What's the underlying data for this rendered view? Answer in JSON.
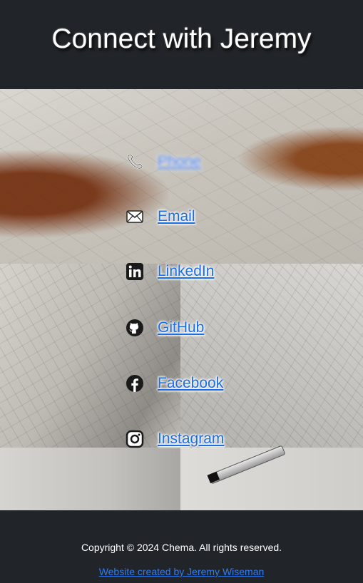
{
  "header": {
    "title": "Connect with Jeremy"
  },
  "links": [
    {
      "label": "Phone",
      "icon": "phone-icon"
    },
    {
      "label": "Email",
      "icon": "envelope-icon"
    },
    {
      "label": "LinkedIn",
      "icon": "linkedin-icon"
    },
    {
      "label": "GitHub",
      "icon": "github-icon"
    },
    {
      "label": "Facebook",
      "icon": "facebook-icon"
    },
    {
      "label": "Instagram",
      "icon": "instagram-icon"
    }
  ],
  "footer": {
    "copyright": "Copyright © 2024 Chema. All rights reserved.",
    "credit_link": "Website created by Jeremy Wiseman"
  },
  "colors": {
    "background": "#212529",
    "link": "#1a6fe6",
    "footer_text": "#ffffff"
  }
}
